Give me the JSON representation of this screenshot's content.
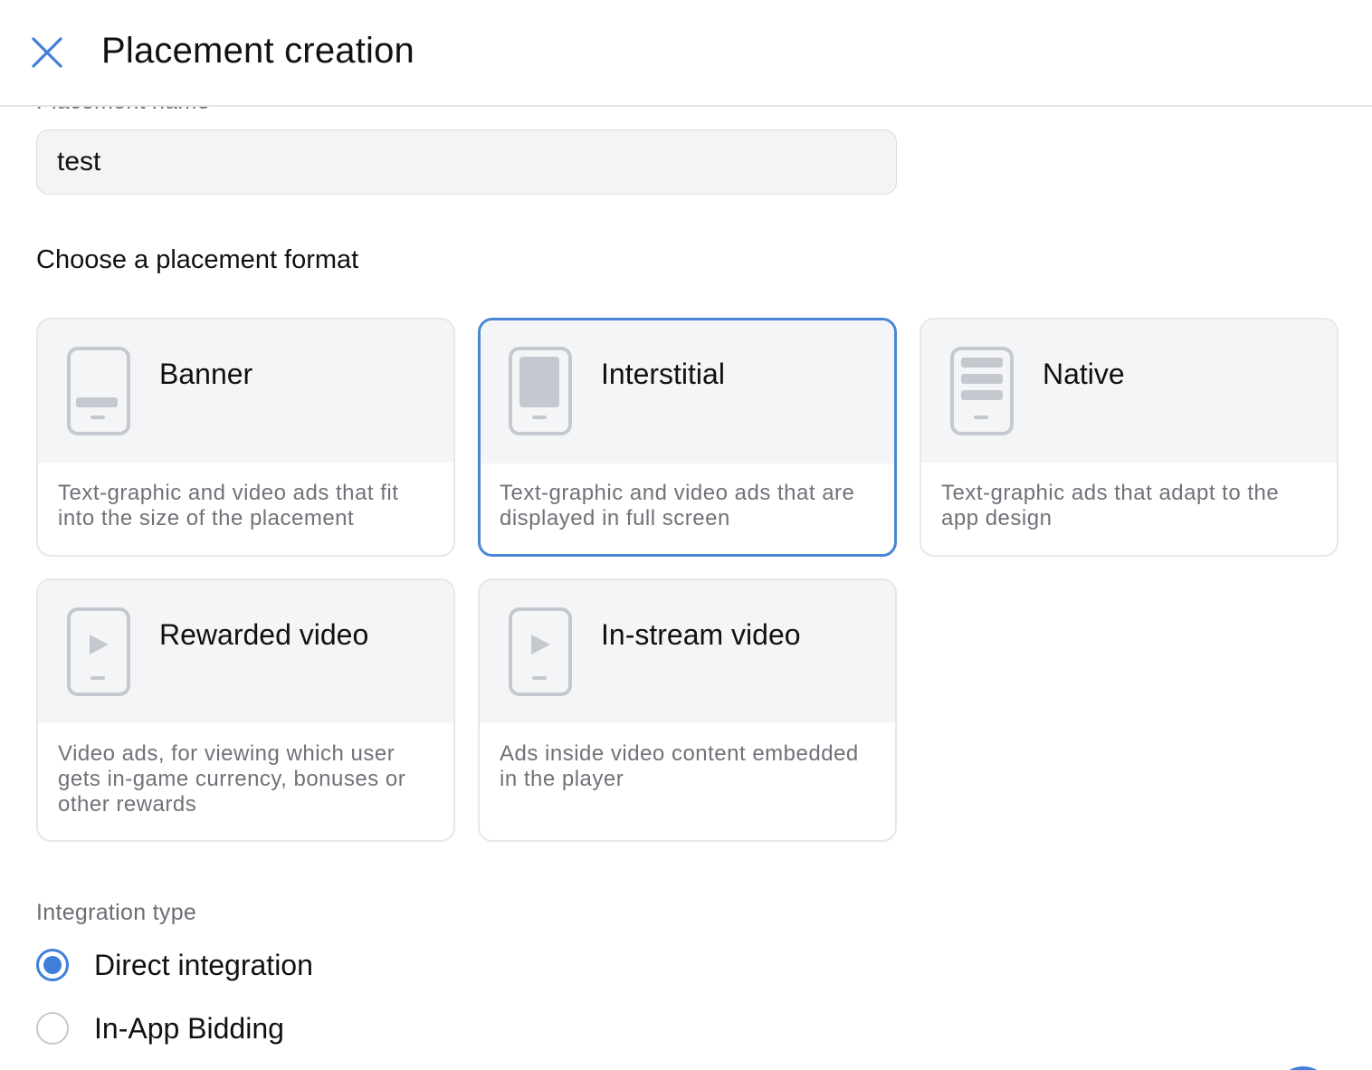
{
  "header": {
    "title": "Placement creation",
    "close_icon": "close-icon"
  },
  "form": {
    "name_label": "Placement name",
    "required_mark": "*",
    "name_value": "test"
  },
  "format_section": {
    "title": "Choose a placement format",
    "cards": [
      {
        "title": "Banner",
        "description": "Text-graphic and video ads that fit into the size of the placement",
        "icon": "banner-phone-icon",
        "selected": false
      },
      {
        "title": "Interstitial",
        "description": "Text-graphic and video ads that are displayed in full screen",
        "icon": "interstitial-phone-icon",
        "selected": true
      },
      {
        "title": "Native",
        "description": "Text-graphic ads that adapt to the app design",
        "icon": "native-phone-icon",
        "selected": false
      },
      {
        "title": "Rewarded video",
        "description": "Video ads, for viewing which user gets in-game currency, bonuses or other rewards",
        "icon": "rewarded-video-phone-icon",
        "selected": false
      },
      {
        "title": "In-stream video",
        "description": "Ads inside video content embedded in the player",
        "icon": "instream-video-phone-icon",
        "selected": false
      }
    ]
  },
  "integration": {
    "label": "Integration type",
    "options": [
      {
        "label": "Direct integration",
        "checked": true
      },
      {
        "label": "In-App Bidding",
        "checked": false
      }
    ]
  },
  "colors": {
    "accent": "#3f7fd9",
    "card_selected_border": "#4a86d6",
    "icon_gray": "#c5c9cf"
  }
}
